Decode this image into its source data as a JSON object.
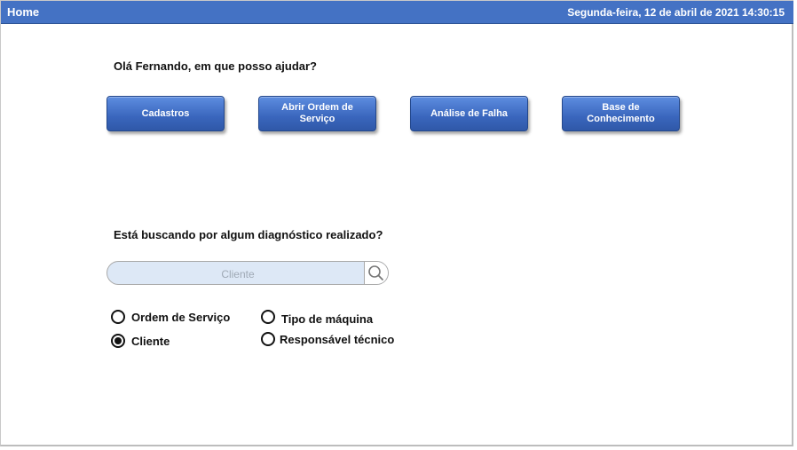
{
  "header": {
    "title": "Home",
    "datetime": "Segunda-feira, 12 de abril de 2021 14:30:15"
  },
  "greeting": "Olá Fernando, em que posso ajudar?",
  "actions": [
    {
      "label": "Cadastros"
    },
    {
      "label": "Abrir Ordem de Serviço"
    },
    {
      "label": "Análise de Falha"
    },
    {
      "label": "Base de Conhecimento"
    }
  ],
  "search": {
    "question": "Está buscando por algum diagnóstico realizado?",
    "placeholder": "Cliente",
    "value": "",
    "icon": "search-icon"
  },
  "filters": [
    {
      "label": "Ordem de Serviço",
      "checked": false
    },
    {
      "label": "Cliente",
      "checked": true
    },
    {
      "label": "Tipo de máquina",
      "checked": false
    },
    {
      "label": "Responsável técnico",
      "checked": false
    }
  ],
  "colors": {
    "header_bg": "#4472c4",
    "button_bg": "#3a66bd",
    "search_bg": "#dde8f6"
  }
}
